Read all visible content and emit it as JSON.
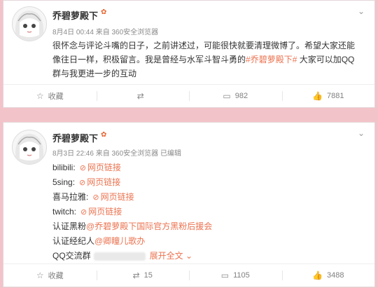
{
  "post1": {
    "author": "乔碧萝殿下",
    "vip_badge": "✿",
    "meta": "8月4日 00:44 来自 360安全浏览器",
    "text_a": "很怀念与评论斗嘴的日子，之前讲述过，可能很快就要清理微博了。希望大家还能像往日一样，积极留言。我是曾经与水军斗智斗勇的",
    "hashtag": "#乔碧萝殿下#",
    "text_b": " 大家可以加QQ群与我更进一步的互动",
    "actions": {
      "favorite": "收藏",
      "repost": "",
      "comments": "982",
      "likes": "7881"
    }
  },
  "post2": {
    "author": "乔碧萝殿下",
    "vip_badge": "✿",
    "meta": "8月3日 22:46 来自 360安全浏览器  已编辑",
    "lines": {
      "bilibili": "bilibili:",
      "fivesing": "5sing:",
      "ximalaya": "喜马拉雅:",
      "twitch": "twitch:",
      "fans_label": "认证黑粉",
      "fans_value": "@乔碧萝殿下国际官方黑粉后援会",
      "agent_label": "认证经纪人",
      "agent_value": "@卿瞳儿歌办",
      "qq_label": "QQ交流群",
      "expand": "展开全文 ⌄"
    },
    "link_text": "网页链接",
    "actions": {
      "favorite": "收藏",
      "repost": "15",
      "comments": "1105",
      "likes": "3488"
    }
  },
  "icons": {
    "chevron": "⌄",
    "link": "⊘",
    "fav": "☆",
    "repost": "⇄",
    "comment": "▭",
    "like": "👍"
  },
  "colors": {
    "accent": "#eb7350",
    "background": "#f2c4c9"
  }
}
